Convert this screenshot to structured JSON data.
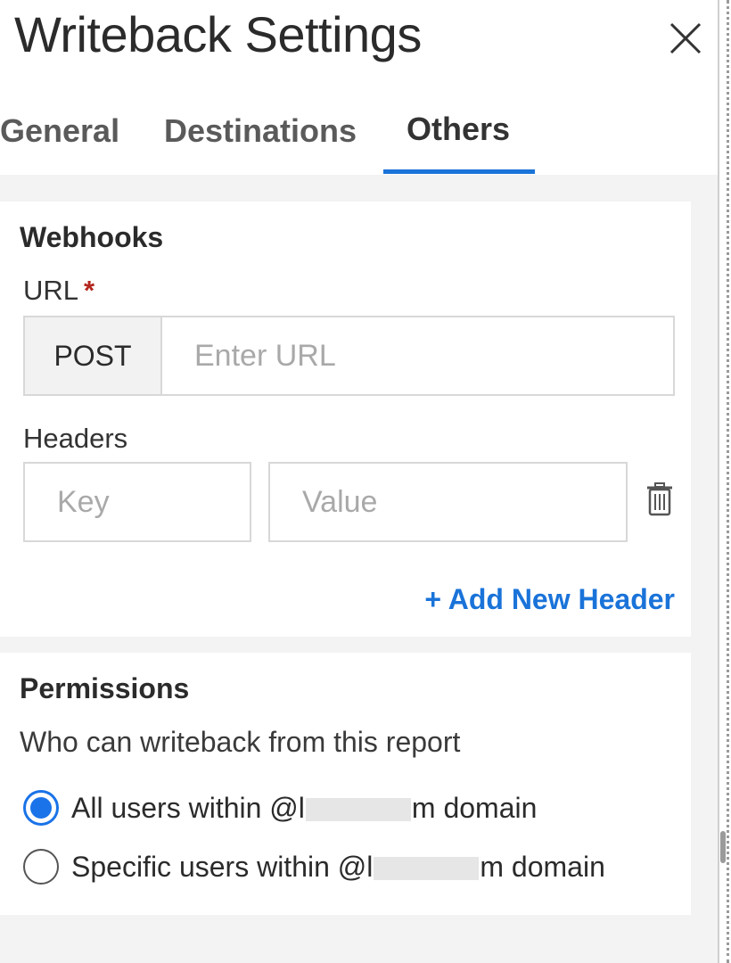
{
  "dialog": {
    "title": "Writeback Settings"
  },
  "tabs": [
    {
      "label": "General",
      "active": false
    },
    {
      "label": "Destinations",
      "active": false
    },
    {
      "label": "Others",
      "active": true
    }
  ],
  "webhooks": {
    "section_title": "Webhooks",
    "url_label": "URL",
    "required_marker": "*",
    "method": "POST",
    "url_placeholder": "Enter URL",
    "url_value": "",
    "headers_label": "Headers",
    "key_placeholder": "Key",
    "value_placeholder": "Value",
    "add_header_label": "+ Add New Header"
  },
  "permissions": {
    "section_title": "Permissions",
    "description": "Who can writeback from this report",
    "options": [
      {
        "prefix": "All users within @l",
        "suffix": "m domain",
        "selected": true
      },
      {
        "prefix": "Specific users within @l",
        "suffix": "m domain",
        "selected": false
      }
    ]
  },
  "colors": {
    "accent": "#1a73d9",
    "required": "#b3261e"
  }
}
